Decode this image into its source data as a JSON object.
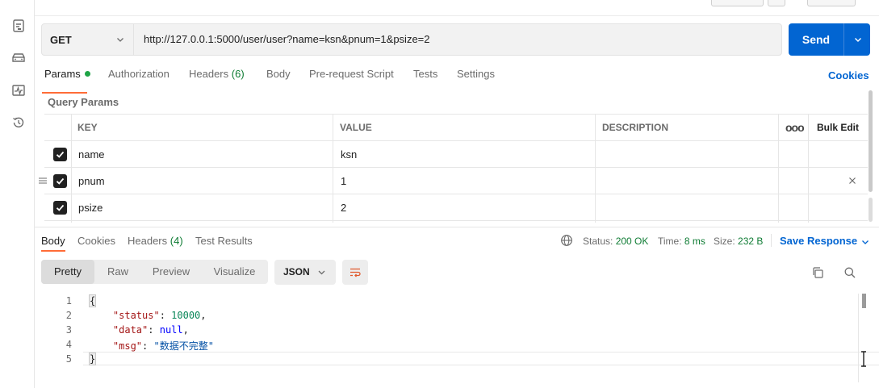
{
  "sidebar_icons": [
    "new-request-icon",
    "environment-icon",
    "monitor-icon",
    "history-icon"
  ],
  "request": {
    "method": "GET",
    "url": "http://127.0.0.1:5000/user/user?name=ksn&pnum=1&psize=2",
    "send_label": "Send"
  },
  "tabs": {
    "params": "Params",
    "authorization": "Authorization",
    "headers": "Headers",
    "headers_count": "(6)",
    "body": "Body",
    "prerequest": "Pre-request Script",
    "tests": "Tests",
    "settings": "Settings",
    "cookies": "Cookies"
  },
  "query_params": {
    "label": "Query Params",
    "columns": {
      "key": "KEY",
      "value": "VALUE",
      "description": "DESCRIPTION",
      "bulk_edit": "Bulk Edit"
    },
    "rows": [
      {
        "checked": true,
        "key": "name",
        "value": "ksn",
        "description": ""
      },
      {
        "checked": true,
        "key": "pnum",
        "value": "1",
        "description": ""
      },
      {
        "checked": true,
        "key": "psize",
        "value": "2",
        "description": ""
      }
    ]
  },
  "response": {
    "tabs": {
      "body": "Body",
      "cookies": "Cookies",
      "headers": "Headers",
      "headers_count": "(4)",
      "test_results": "Test Results"
    },
    "status_label": "Status:",
    "status_value": "200 OK",
    "time_label": "Time:",
    "time_value": "8 ms",
    "size_label": "Size:",
    "size_value": "232 B",
    "save_label": "Save Response",
    "views": {
      "pretty": "Pretty",
      "raw": "Raw",
      "preview": "Preview",
      "visualize": "Visualize"
    },
    "format": "JSON",
    "line_numbers": [
      "1",
      "2",
      "3",
      "4",
      "5"
    ],
    "body": {
      "open": "{",
      "close": "}",
      "status_key": "\"status\"",
      "status_val": "10000",
      "data_key": "\"data\"",
      "data_val": "null",
      "msg_key": "\"msg\"",
      "msg_val": "\"数据不完整\""
    }
  }
}
